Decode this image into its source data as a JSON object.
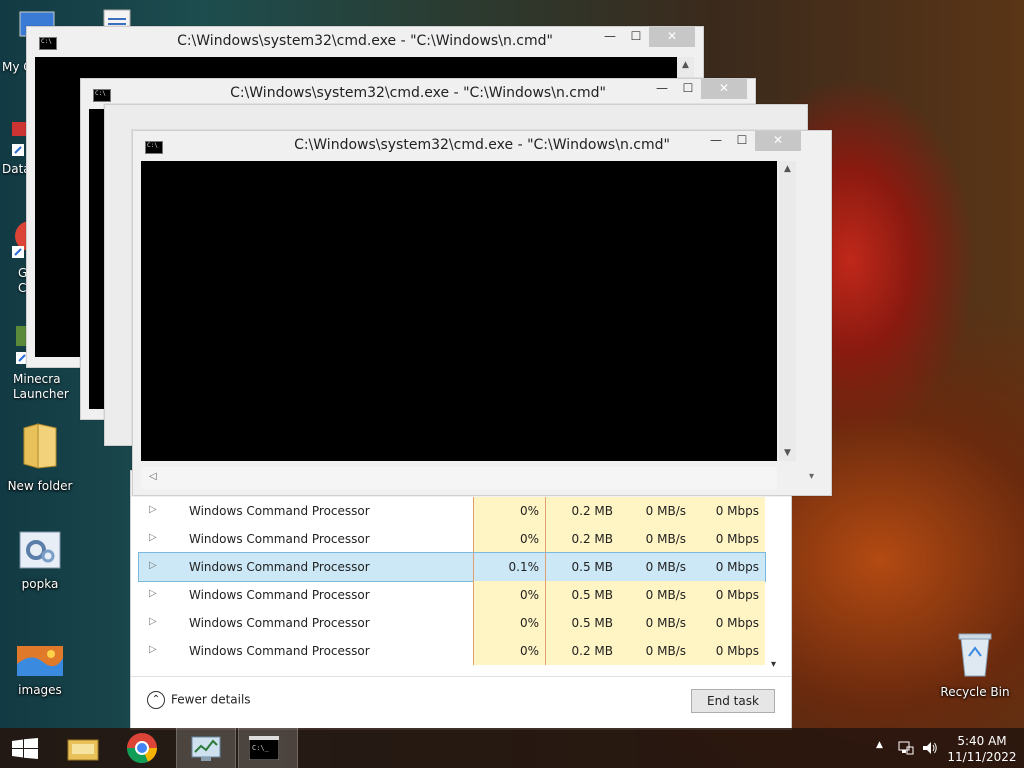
{
  "desktop": {
    "icons": [
      {
        "id": "new-folder",
        "label": "New folder"
      },
      {
        "id": "popka",
        "label": "popka"
      },
      {
        "id": "images",
        "label": "images"
      },
      {
        "id": "recycle-bin",
        "label": "Recycle Bin"
      }
    ],
    "clipped_labels": {
      "my_computer": "My C",
      "data": "Data",
      "google_chrome_1": "G",
      "google_chrome_2": "C",
      "minecraft_1": "Minecra",
      "minecraft_2": "Launcher"
    }
  },
  "cmd_windows": [
    {
      "title": "C:\\Windows\\system32\\cmd.exe - \"C:\\Windows\\n.cmd\""
    },
    {
      "title": "C:\\Windows\\system32\\cmd.exe - \"C:\\Windows\\n.cmd\""
    },
    {
      "title": "C:\\Windows\\system32\\cmd.exe - \"C:\\Windows\\n.cmd\""
    }
  ],
  "window_buttons": {
    "minimize": "—",
    "maximize": "☐",
    "close": "✕"
  },
  "task_manager": {
    "rows": [
      {
        "name": "Windows Command Processor",
        "cpu": "0%",
        "memory": "0.2 MB",
        "disk": "0 MB/s",
        "network": "0 Mbps"
      },
      {
        "name": "Windows Command Processor",
        "cpu": "0%",
        "memory": "0.2 MB",
        "disk": "0 MB/s",
        "network": "0 Mbps"
      },
      {
        "name": "Windows Command Processor",
        "cpu": "0.1%",
        "memory": "0.5 MB",
        "disk": "0 MB/s",
        "network": "0 Mbps",
        "selected": true
      },
      {
        "name": "Windows Command Processor",
        "cpu": "0%",
        "memory": "0.5 MB",
        "disk": "0 MB/s",
        "network": "0 Mbps"
      },
      {
        "name": "Windows Command Processor",
        "cpu": "0%",
        "memory": "0.5 MB",
        "disk": "0 MB/s",
        "network": "0 Mbps"
      },
      {
        "name": "Windows Command Processor",
        "cpu": "0%",
        "memory": "0.2 MB",
        "disk": "0 MB/s",
        "network": "0 Mbps"
      }
    ],
    "fewer_details": "Fewer details",
    "end_task": "End task"
  },
  "taskbar": {
    "time": "5:40 AM",
    "date": "11/11/2022"
  },
  "colors": {
    "cpu_column": "#fff4c4",
    "selected_row": "#cce8f6",
    "taskbar": "#26140e"
  }
}
